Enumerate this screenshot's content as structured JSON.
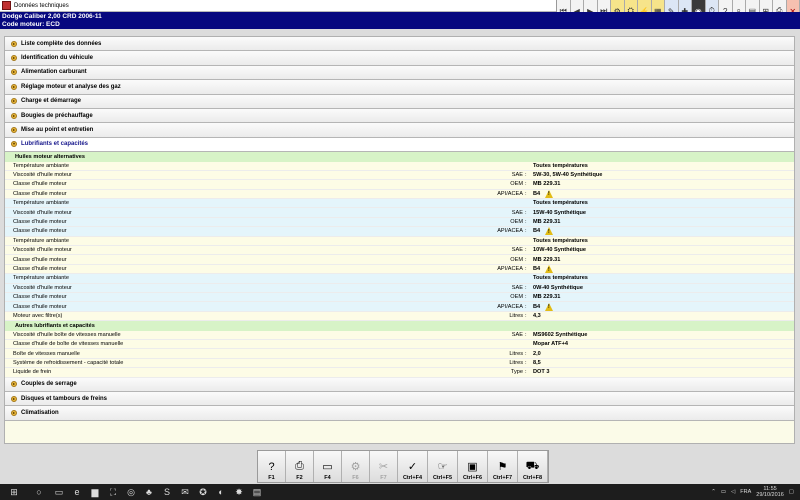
{
  "window": {
    "title": "Données techniques"
  },
  "vehicle": {
    "line1": "Dodge   Caliber  2,00  CRD 2006-11",
    "line2": "Code moteur: ECD"
  },
  "toolbar_icons": [
    {
      "name": "first-page-icon",
      "glyph": "⏮",
      "style": ""
    },
    {
      "name": "prev-page-icon",
      "glyph": "◀",
      "style": ""
    },
    {
      "name": "next-page-icon",
      "glyph": "▶",
      "style": ""
    },
    {
      "name": "last-page-icon",
      "glyph": "⏭",
      "style": ""
    },
    {
      "name": "adjust-icon",
      "glyph": "⚙",
      "style": "yellow"
    },
    {
      "name": "engine-icon",
      "glyph": "⛭",
      "style": "yellow"
    },
    {
      "name": "electrical-icon",
      "glyph": "⚡",
      "style": "yellow"
    },
    {
      "name": "diagram-icon",
      "glyph": "▦",
      "style": "yellow"
    },
    {
      "name": "maintenance-icon",
      "glyph": "✎",
      "style": "blue"
    },
    {
      "name": "wrench-icon",
      "glyph": "✚",
      "style": "blue"
    },
    {
      "name": "tyre-icon",
      "glyph": "◉",
      "style": "dark"
    },
    {
      "name": "repair-time-icon",
      "glyph": "⏱",
      "style": "blue"
    },
    {
      "name": "help-icon",
      "glyph": "?",
      "style": ""
    },
    {
      "name": "search-icon",
      "glyph": "⌕",
      "style": ""
    },
    {
      "name": "document-icon",
      "glyph": "▤",
      "style": ""
    },
    {
      "name": "cart-icon",
      "glyph": "⊞",
      "style": ""
    },
    {
      "name": "print-icon",
      "glyph": "⎙",
      "style": ""
    },
    {
      "name": "close-icon",
      "glyph": "✕",
      "style": "red"
    }
  ],
  "sections_top": [
    {
      "label": "Liste complète des données"
    },
    {
      "label": "Identification du véhicule"
    },
    {
      "label": "Alimentation carburant"
    },
    {
      "label": "Réglage moteur et analyse des gaz"
    },
    {
      "label": "Charge et démarrage"
    },
    {
      "label": "Bougies de préchauffage"
    },
    {
      "label": "Mise au point et entretien"
    }
  ],
  "open_section": {
    "label": "Lubrifiants et capacités"
  },
  "subheads": {
    "engine_oils": "Huiles moteur alternatives",
    "other": "Autres lubrifiants et capacités"
  },
  "rows_oils": [
    {
      "label": "Température ambiante",
      "std": "",
      "sep": "",
      "value": "Toutes températures",
      "warn": false,
      "bg": "y"
    },
    {
      "label": "Viscosité d'huile moteur",
      "std": "SAE",
      "sep": ":",
      "value": "5W-30, 5W-40 Synthétique",
      "warn": false,
      "bg": "y"
    },
    {
      "label": "Classe d'huile moteur",
      "std": "OEM",
      "sep": ":",
      "value": "MB 229.31",
      "warn": false,
      "bg": "y"
    },
    {
      "label": "Classe d'huile moteur",
      "std": "API/ACEA",
      "sep": ":",
      "value": "B4",
      "warn": true,
      "bg": "y"
    },
    {
      "label": "Température ambiante",
      "std": "",
      "sep": "",
      "value": "Toutes températures",
      "warn": false,
      "bg": "b"
    },
    {
      "label": "Viscosité d'huile moteur",
      "std": "SAE",
      "sep": ":",
      "value": "15W-40 Synthétique",
      "warn": false,
      "bg": "b"
    },
    {
      "label": "Classe d'huile moteur",
      "std": "OEM",
      "sep": ":",
      "value": "MB 229.31",
      "warn": false,
      "bg": "b"
    },
    {
      "label": "Classe d'huile moteur",
      "std": "API/ACEA",
      "sep": ":",
      "value": "B4",
      "warn": true,
      "bg": "b"
    },
    {
      "label": "Température ambiante",
      "std": "",
      "sep": "",
      "value": "Toutes températures",
      "warn": false,
      "bg": "y"
    },
    {
      "label": "Viscosité d'huile moteur",
      "std": "SAE",
      "sep": ":",
      "value": "10W-40 Synthétique",
      "warn": false,
      "bg": "y"
    },
    {
      "label": "Classe d'huile moteur",
      "std": "OEM",
      "sep": ":",
      "value": "MB 229.31",
      "warn": false,
      "bg": "y"
    },
    {
      "label": "Classe d'huile moteur",
      "std": "API/ACEA",
      "sep": ":",
      "value": "B4",
      "warn": true,
      "bg": "y"
    },
    {
      "label": "Température ambiante",
      "std": "",
      "sep": "",
      "value": "Toutes températures",
      "warn": false,
      "bg": "b"
    },
    {
      "label": "Viscosité d'huile moteur",
      "std": "SAE",
      "sep": ":",
      "value": "0W-40 Synthétique",
      "warn": false,
      "bg": "b"
    },
    {
      "label": "Classe d'huile moteur",
      "std": "OEM",
      "sep": ":",
      "value": "MB 229.31",
      "warn": false,
      "bg": "b"
    },
    {
      "label": "Classe d'huile moteur",
      "std": "API/ACEA",
      "sep": ":",
      "value": "B4",
      "warn": true,
      "bg": "b"
    },
    {
      "label": "Moteur avec filtre(s)",
      "std": "Litres",
      "sep": ":",
      "value": "4,3",
      "warn": false,
      "bg": "y"
    }
  ],
  "rows_other": [
    {
      "label": "Viscosité d'huile boîte de vitesses manuelle",
      "std": "SAE",
      "sep": ":",
      "value": "MS9602 Synthétique",
      "warn": false,
      "bg": "y"
    },
    {
      "label": "Classe d'huile de boîte de vitesses manuelle",
      "std": "",
      "sep": "",
      "value": "Mopar ATF+4",
      "warn": false,
      "bg": "y"
    },
    {
      "label": "Boîte de vitesses manuelle",
      "std": "Litres",
      "sep": ":",
      "value": "2,0",
      "warn": false,
      "bg": "y"
    },
    {
      "label": "Système de refroidissement - capacité totale",
      "std": "Litres",
      "sep": ":",
      "value": "8,5",
      "warn": false,
      "bg": "y"
    },
    {
      "label": "Liquide de frein",
      "std": "Type",
      "sep": ":",
      "value": "DOT 3",
      "warn": false,
      "bg": "y"
    }
  ],
  "sections_bottom": [
    {
      "label": "Couples de serrage"
    },
    {
      "label": "Disques et tambours de freins"
    },
    {
      "label": "Climatisation"
    }
  ],
  "fkeys": [
    {
      "name": "help-key",
      "icon": "?",
      "label": "F1",
      "disabled": false
    },
    {
      "name": "print-key",
      "icon": "⎙",
      "label": "F2",
      "disabled": false
    },
    {
      "name": "screen-key",
      "icon": "▭",
      "label": "F4",
      "disabled": false
    },
    {
      "name": "f6-key",
      "icon": "⚙",
      "label": "F6",
      "disabled": true
    },
    {
      "name": "f7-key",
      "icon": "✂",
      "label": "F7",
      "disabled": true
    },
    {
      "name": "ctrl-f4-key",
      "icon": "✓",
      "label": "Ctrl+F4",
      "disabled": false
    },
    {
      "name": "ctrl-f5-key",
      "icon": "☞",
      "label": "Ctrl+F5",
      "disabled": false
    },
    {
      "name": "ctrl-f6-key",
      "icon": "▣",
      "label": "Ctrl+F6",
      "disabled": false
    },
    {
      "name": "ctrl-f7-key",
      "icon": "⚑",
      "label": "Ctrl+F7",
      "disabled": false
    },
    {
      "name": "ctrl-f8-key",
      "icon": "⛟",
      "label": "Ctrl+F8",
      "disabled": false
    }
  ],
  "taskbar": {
    "apps": [
      {
        "name": "start-icon",
        "glyph": "⊞"
      },
      {
        "name": "search-icon",
        "glyph": "○"
      },
      {
        "name": "task-view-icon",
        "glyph": "▭"
      },
      {
        "name": "edge-icon",
        "glyph": "e"
      },
      {
        "name": "explorer-icon",
        "glyph": "▆"
      },
      {
        "name": "store-icon",
        "glyph": "⛶"
      },
      {
        "name": "chrome-icon",
        "glyph": "◎"
      },
      {
        "name": "app-icon",
        "glyph": "♣"
      },
      {
        "name": "skype-icon",
        "glyph": "S"
      },
      {
        "name": "outlook-icon",
        "glyph": "✉"
      },
      {
        "name": "app2-icon",
        "glyph": "✪"
      },
      {
        "name": "firefox-icon",
        "glyph": "◐"
      },
      {
        "name": "app3-icon",
        "glyph": "✸"
      },
      {
        "name": "active-app-icon",
        "glyph": "▤"
      }
    ],
    "language": "FRA",
    "time": "11:55",
    "date": "29/10/2016"
  }
}
